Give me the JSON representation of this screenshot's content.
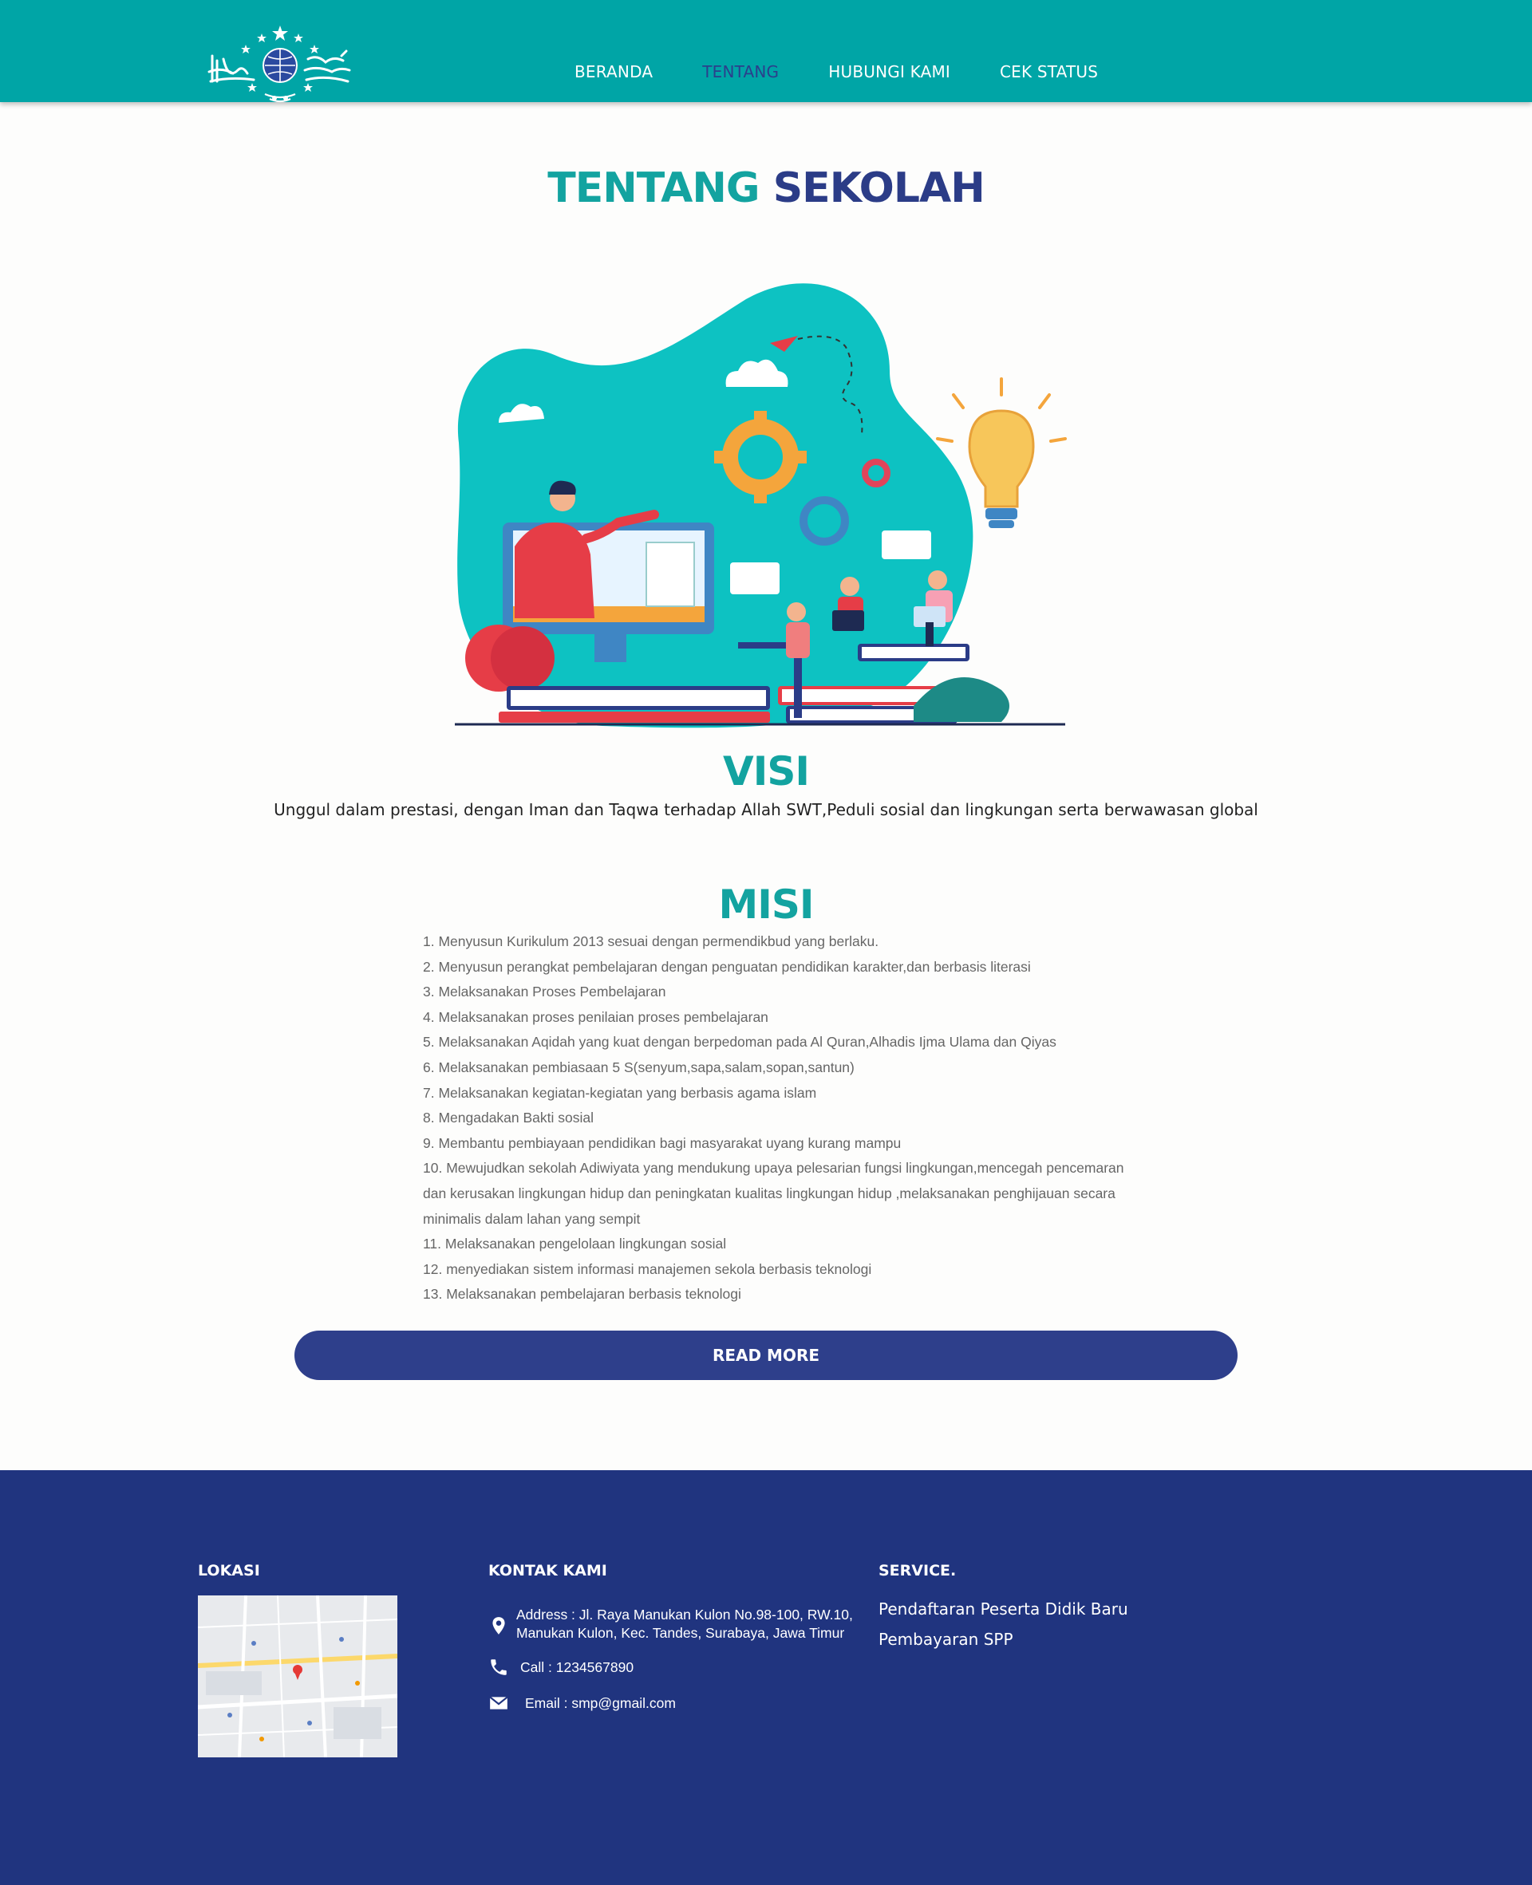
{
  "nav": {
    "items": [
      {
        "label": "BERANDA",
        "active": false
      },
      {
        "label": "TENTANG",
        "active": true
      },
      {
        "label": "HUBUNGI KAMI",
        "active": false
      },
      {
        "label": "CEK STATUS",
        "active": false
      }
    ],
    "bg_color": "#00a5a6",
    "active_color": "#2b3f8c"
  },
  "page_title": {
    "part1": "TENTANG",
    "part2": "SEKOLAH"
  },
  "visi": {
    "heading": "VISI",
    "text": "Unggul dalam prestasi, dengan Iman dan Taqwa terhadap Allah SWT,Peduli sosial dan lingkungan serta berwawasan global"
  },
  "misi": {
    "heading": "MISI",
    "items": [
      "1. Menyusun Kurikulum 2013 sesuai dengan permendikbud yang berlaku.",
      "2. Menyusun perangkat pembelajaran dengan penguatan pendidikan karakter,dan berbasis literasi",
      "3. Melaksanakan Proses Pembelajaran",
      "4. Melaksanakan proses penilaian proses pembelajaran",
      "5. Melaksanakan Aqidah yang kuat dengan berpedoman pada Al Quran,Alhadis Ijma Ulama dan Qiyas",
      "6. Melaksanakan pembiasaan 5 S(senyum,sapa,salam,sopan,santun)",
      "7. Melaksanakan kegiatan-kegiatan yang berbasis agama islam",
      "8. Mengadakan Bakti sosial",
      "9. Membantu pembiayaan pendidikan bagi masyarakat uyang kurang mampu",
      "10. Mewujudkan sekolah Adiwiyata yang mendukung upaya pelesarian fungsi lingkungan,mencegah pencemaran dan kerusakan lingkungan hidup dan peningkatan kualitas lingkungan hidup ,melaksanakan penghijauan secara minimalis dalam lahan yang sempit",
      "11. Melaksanakan pengelolaan lingkungan sosial",
      "12. menyediakan sistem informasi manajemen sekola berbasis teknologi",
      "13. Melaksanakan pembelajaran berbasis teknologi"
    ]
  },
  "read_more": "READ MORE",
  "footer": {
    "lokasi": {
      "heading": "LOKASI"
    },
    "kontak": {
      "heading": "KONTAK KAMI",
      "address_line1": "Address : Jl. Raya Manukan Kulon No.98-100, RW.10,",
      "address_line2": "Manukan Kulon, Kec. Tandes, Surabaya, Jawa Timur",
      "call": "Call : 1234567890",
      "email": "Email : smp@gmail.com"
    },
    "service": {
      "heading": "SERVICE.",
      "items": [
        "Pendaftaran Peserta Didik Baru",
        "Pembayaran SPP"
      ]
    },
    "bg_color": "#20347f"
  },
  "colors": {
    "teal": "#13a3a0",
    "navy": "#2b3c87",
    "button": "#2e3f8b"
  },
  "icons": [
    "school-logo",
    "map-pin-icon",
    "phone-icon",
    "envelope-icon"
  ]
}
